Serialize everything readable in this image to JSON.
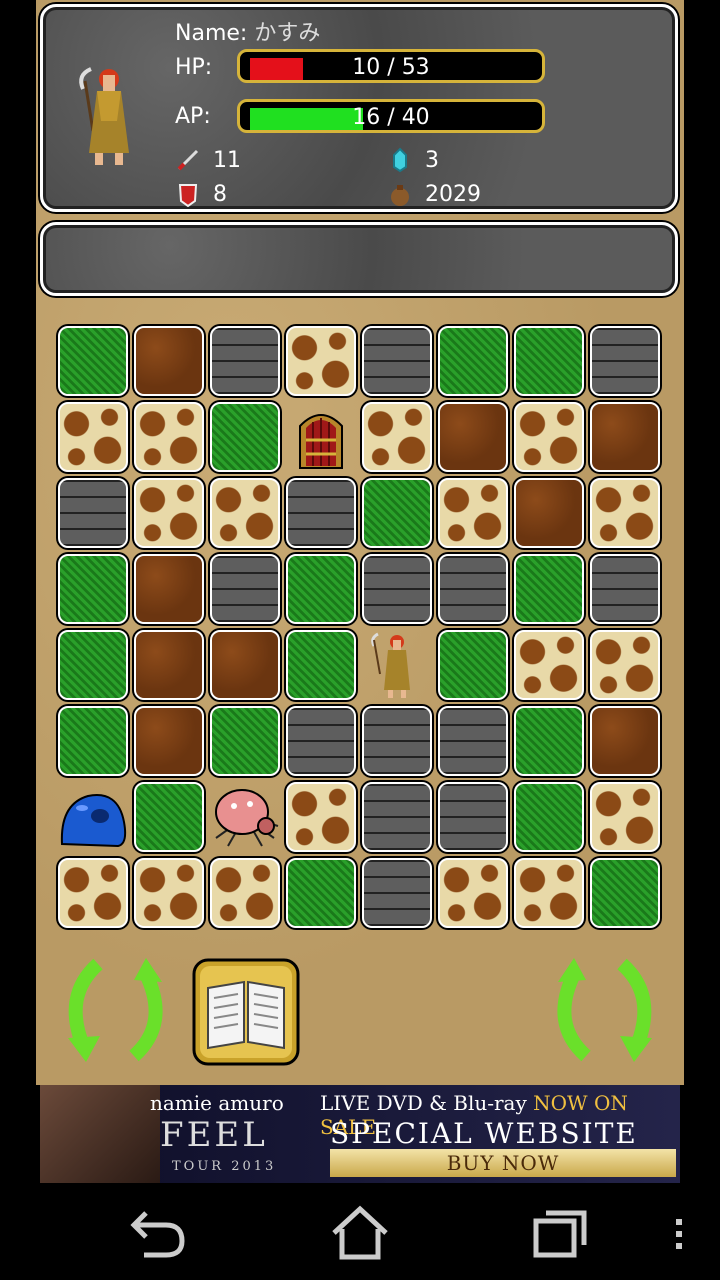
{
  "status": {
    "name_label": "Name:",
    "name_value": "かすみ",
    "hp_label": "HP:",
    "hp_text": "10 / 53",
    "hp_current": 10,
    "hp_max": 53,
    "ap_label": "AP:",
    "ap_text": "16 / 40",
    "ap_current": 16,
    "ap_max": 40,
    "attack": "11",
    "crystals": "3",
    "defense": "8",
    "gold": "2029",
    "colors": {
      "hp": "#e4101a",
      "ap": "#20e020",
      "bar_border": "#d6b43a"
    }
  },
  "message": "",
  "board": {
    "rows": [
      [
        "grass",
        "dirt",
        "stone",
        "spot",
        "stone",
        "grass",
        "grass",
        "stone"
      ],
      [
        "spot",
        "spot",
        "grass",
        "door",
        "spot",
        "dirt",
        "spot",
        "dirt"
      ],
      [
        "stone",
        "spot",
        "spot",
        "stone",
        "grass",
        "spot",
        "dirt",
        "spot"
      ],
      [
        "grass",
        "dirt",
        "stone",
        "grass",
        "stone",
        "stone",
        "grass",
        "stone"
      ],
      [
        "grass",
        "dirt",
        "dirt",
        "grass",
        "hero",
        "grass",
        "spot",
        "spot"
      ],
      [
        "grass",
        "dirt",
        "grass",
        "stone",
        "stone",
        "stone",
        "grass",
        "dirt"
      ],
      [
        "slime",
        "grass",
        "spider",
        "spot",
        "stone",
        "stone",
        "grass",
        "spot"
      ],
      [
        "spot",
        "spot",
        "spot",
        "grass",
        "stone",
        "spot",
        "spot",
        "grass"
      ]
    ]
  },
  "controls": {
    "rotate_left": "rotate-left-icon",
    "book": "spellbook-icon",
    "rotate_right": "rotate-right-icon"
  },
  "ad": {
    "artist": "namie amuro",
    "title": "FEEL",
    "tour": "TOUR 2013",
    "line1_a": "LIVE DVD & Blu-ray ",
    "line1_b": "NOW ON SALE",
    "line2": "SPECIAL WEBSITE",
    "button": "BUY NOW"
  },
  "nav": {
    "back": "back-icon",
    "home": "home-icon",
    "recents": "recents-icon",
    "menu": "overflow-menu-icon"
  }
}
